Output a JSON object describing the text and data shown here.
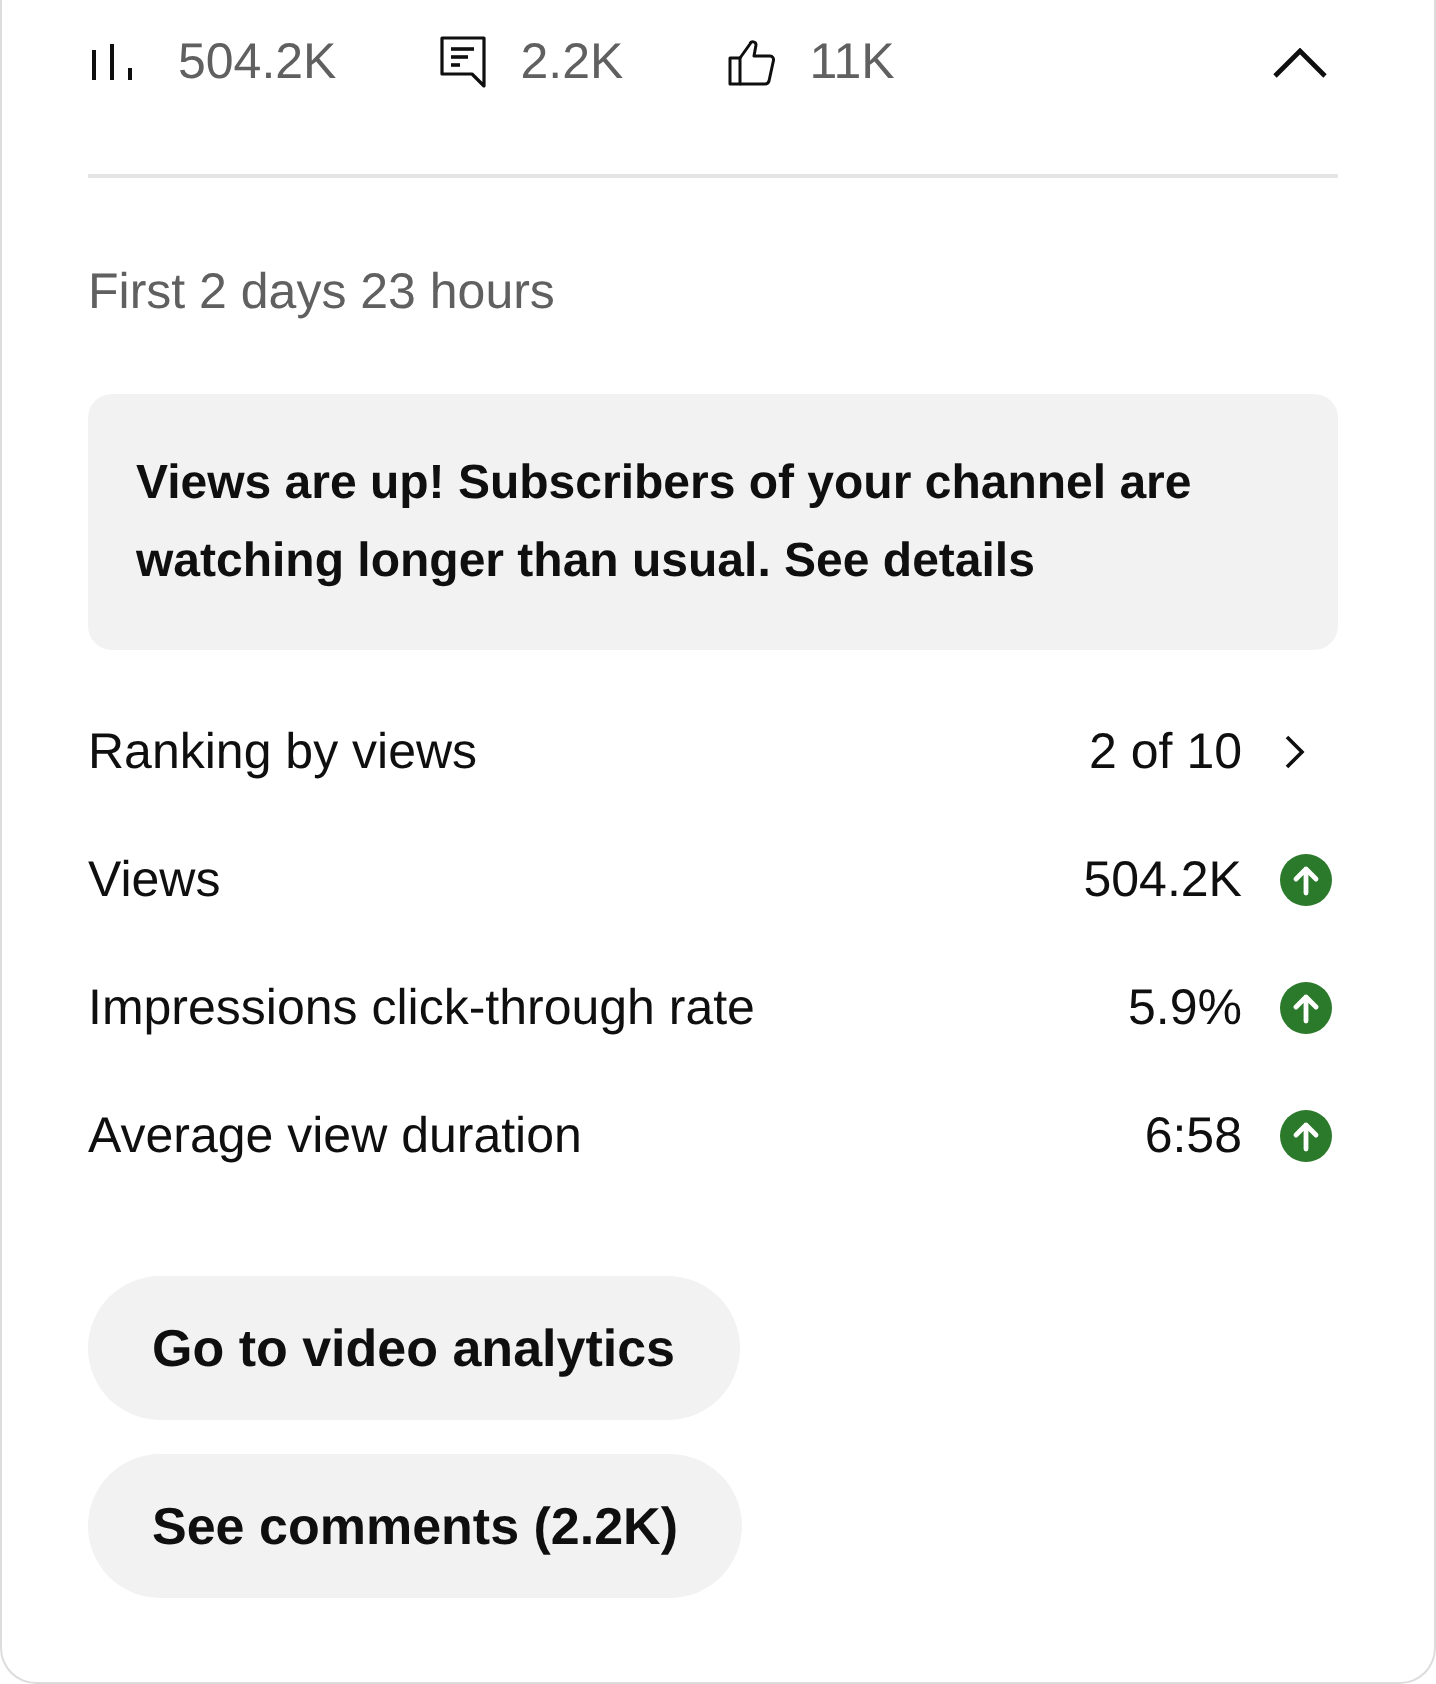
{
  "stats": [
    {
      "kind": "views",
      "value": "504.2K"
    },
    {
      "kind": "comments",
      "value": "2.2K"
    },
    {
      "kind": "likes",
      "value": "11K"
    }
  ],
  "collapse_toggle": {
    "expanded": true
  },
  "period": "First 2 days 23 hours",
  "insight": {
    "text": "Views are up! Subscribers of your channel are watching longer than usual.",
    "link": "See details"
  },
  "metrics": [
    {
      "kind": "ranking",
      "label": "Ranking by views",
      "value": "2 of 10"
    },
    {
      "kind": "metric",
      "label": "Views",
      "value": "504.2K",
      "rising": true
    },
    {
      "kind": "metric",
      "label": "Impressions click-through rate",
      "value": "5.9%",
      "rising": true
    },
    {
      "kind": "metric",
      "label": "Average view duration",
      "value": "6:58",
      "rising": true
    }
  ],
  "buttons": [
    "Go to video analytics",
    "See comments (2.2K)"
  ]
}
